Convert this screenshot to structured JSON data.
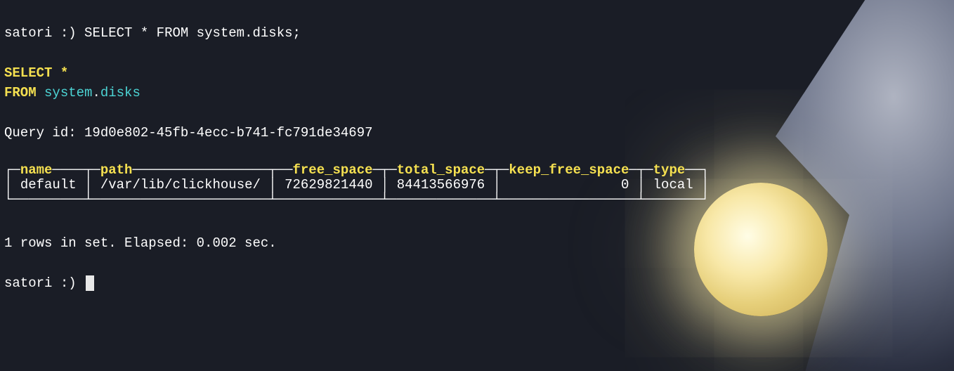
{
  "prompt": {
    "host": "satori",
    "face": ":)",
    "command": "SELECT * FROM system.disks;"
  },
  "echo": {
    "select": "SELECT",
    "star": "*",
    "from": "FROM",
    "schema": "system",
    "dot": ".",
    "table": "disks"
  },
  "query_id_label": "Query id:",
  "query_id": "19d0e802-45fb-4ecc-b741-fc791de34697",
  "table_result": {
    "columns": [
      "name",
      "path",
      "free_space",
      "total_space",
      "keep_free_space",
      "type"
    ],
    "rows": [
      {
        "name": "default",
        "path": "/var/lib/clickhouse/",
        "free_space": "72629821440",
        "total_space": "84413566976",
        "keep_free_space": "0",
        "type": "local"
      }
    ]
  },
  "footer": {
    "summary": "1 rows in set. Elapsed: 0.002 sec."
  },
  "prompt2": {
    "host": "satori",
    "face": ":)"
  }
}
